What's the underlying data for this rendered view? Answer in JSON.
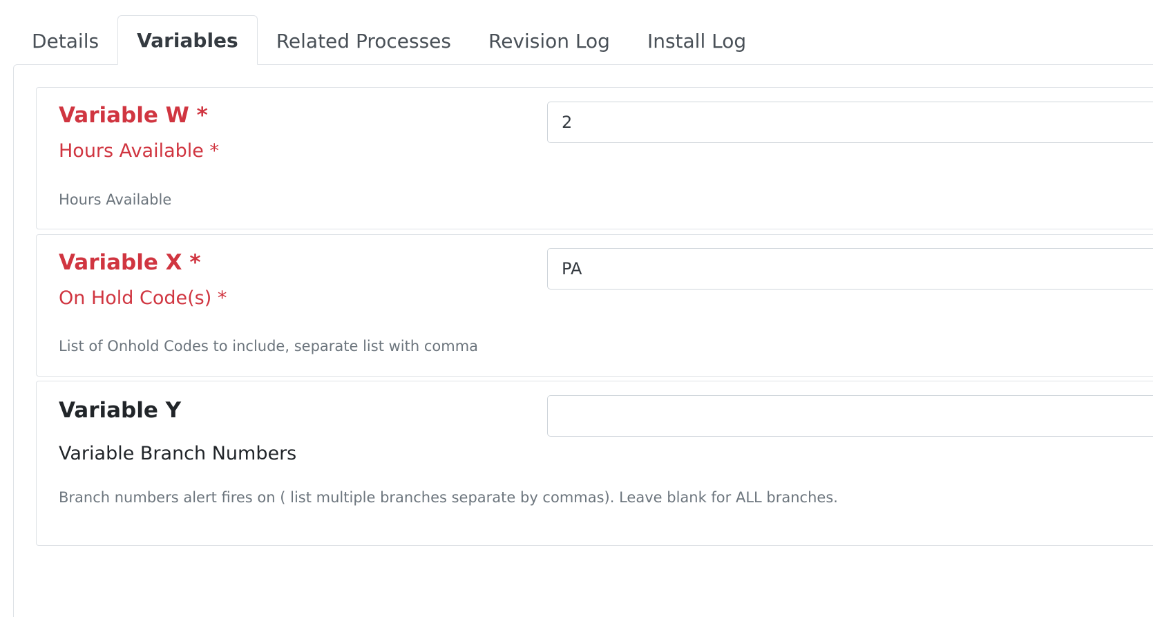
{
  "tabs": [
    {
      "label": "Details"
    },
    {
      "label": "Variables"
    },
    {
      "label": "Related Processes"
    },
    {
      "label": "Revision Log"
    },
    {
      "label": "Install Log"
    }
  ],
  "variables": [
    {
      "title": "Variable W *",
      "label": "Hours Available *",
      "help": "Hours Available",
      "value": "2"
    },
    {
      "title": "Variable X *",
      "label": "On Hold Code(s) *",
      "help": "List of Onhold Codes to include, separate list with comma",
      "value": "PA"
    },
    {
      "title": "Variable Y",
      "label": "Variable Branch Numbers",
      "help": "Branch numbers alert fires on ( list multiple branches separate by commas). Leave blank for ALL branches.",
      "value": ""
    }
  ],
  "colors": {
    "required": "#d03540",
    "help_text": "#6c757d",
    "border": "#dee2e6"
  }
}
